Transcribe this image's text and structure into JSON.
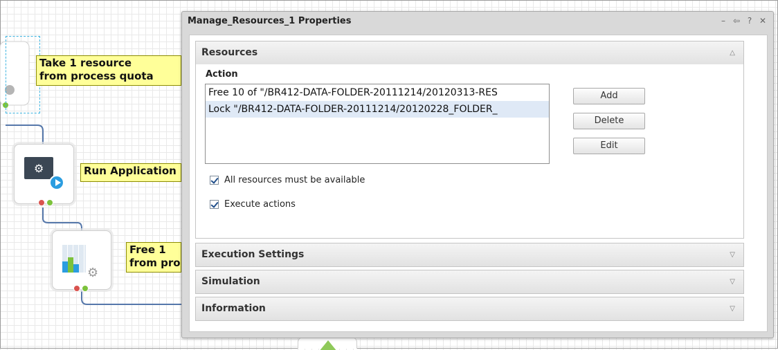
{
  "canvas": {
    "notes": [
      {
        "line1": "Take 1 resource",
        "line2": "from process quota"
      },
      {
        "line1": "Run Application",
        "line2": ""
      },
      {
        "line1": "Free 1",
        "line2": "from process quota"
      }
    ]
  },
  "dialog": {
    "title": "Manage_Resources_1 Properties",
    "controls": {
      "minimize": "–",
      "pin": "⇦",
      "help": "?",
      "close": "✕"
    },
    "sections": {
      "resources": {
        "label": "Resources",
        "action_label": "Action",
        "actions": [
          "Free 10 of \"/BR412-DATA-FOLDER-20111214/20120313-RES",
          "Lock \"/BR412-DATA-FOLDER-20111214/20120228_FOLDER_"
        ],
        "buttons": {
          "add": "Add",
          "delete": "Delete",
          "edit": "Edit"
        },
        "checkboxes": [
          {
            "label": "All resources must be available",
            "checked": true
          },
          {
            "label": "Execute actions",
            "checked": true
          }
        ]
      },
      "execution_settings": {
        "label": "Execution Settings"
      },
      "simulation": {
        "label": "Simulation"
      },
      "information": {
        "label": "Information"
      }
    }
  }
}
